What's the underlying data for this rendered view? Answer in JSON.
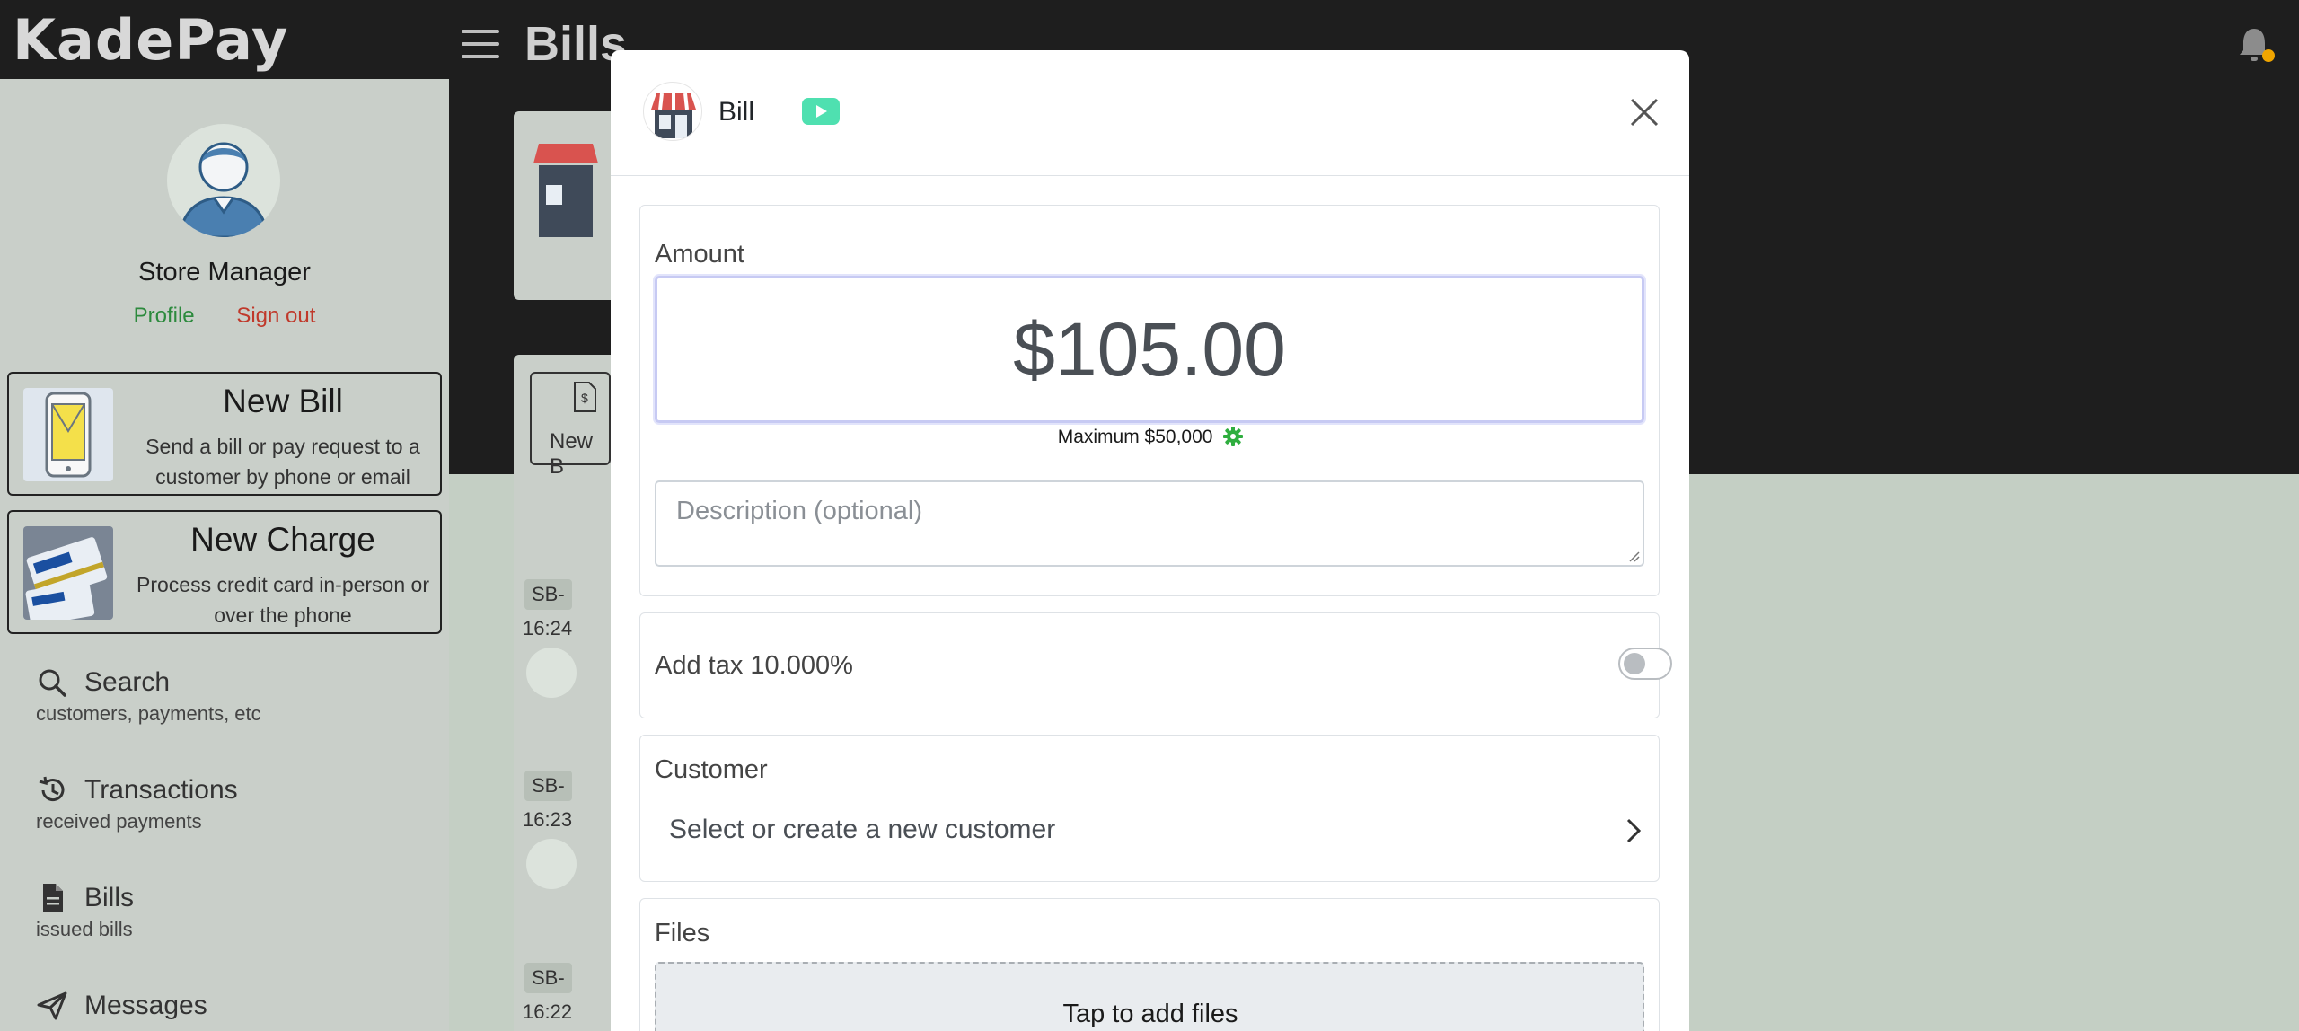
{
  "app": {
    "logo": "KadePay",
    "page_title": "Bills"
  },
  "sidebar": {
    "user_name": "Store Manager",
    "profile_link": "Profile",
    "signout_link": "Sign out",
    "actions": [
      {
        "title": "New Bill",
        "desc": "Send a bill or pay request to a customer by phone or email"
      },
      {
        "title": "New Charge",
        "desc": "Process credit card in-person or over the phone"
      }
    ],
    "nav": [
      {
        "label": "Search",
        "sub": "customers, payments, etc"
      },
      {
        "label": "Transactions",
        "sub": "received payments"
      },
      {
        "label": "Bills",
        "sub": "issued bills"
      },
      {
        "label": "Messages",
        "sub": ""
      }
    ]
  },
  "background": {
    "new_bill_partial": "New B",
    "rows": [
      {
        "tag": "SB-",
        "time": "16:24"
      },
      {
        "tag": "SB-",
        "time": "16:23"
      },
      {
        "tag": "SB-",
        "time": "16:22"
      }
    ]
  },
  "modal": {
    "title": "Bill",
    "amount_label": "Amount",
    "amount_value": "$105.00",
    "max_note": "Maximum $50,000",
    "description_placeholder": "Description (optional)",
    "tax_label": "Add tax 10.000%",
    "tax_enabled": false,
    "customer_label": "Customer",
    "customer_select": "Select or create a new customer",
    "files_label": "Files",
    "files_drop": "Tap to add files"
  },
  "colors": {
    "accent_green": "#2c8a3d",
    "signout_red": "#c0392b",
    "video_button": "#4fe0b0",
    "notification_dot": "#f0a500"
  }
}
